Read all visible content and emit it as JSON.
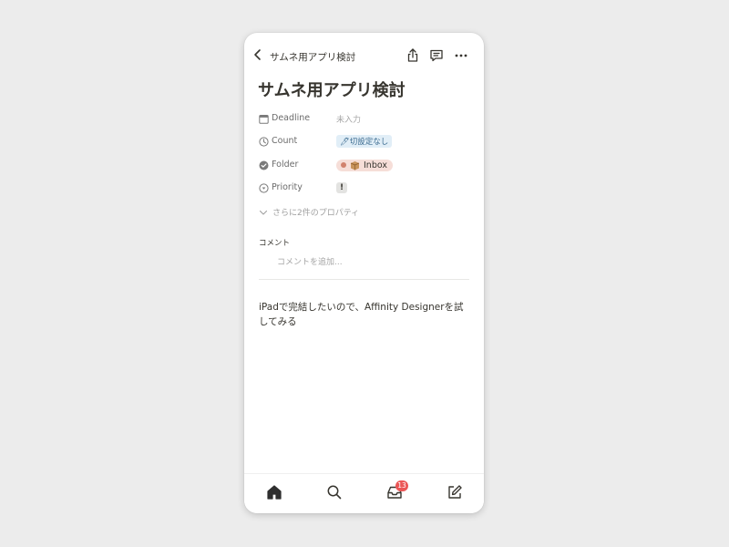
{
  "header": {
    "title": "サムネ用アプリ検討"
  },
  "page": {
    "title": "サムネ用アプリ検討"
  },
  "properties": [
    {
      "label": "Deadline",
      "value": "未入力",
      "icon": "calendar-icon"
    },
    {
      "label": "Count",
      "value": "🖊切設定なし",
      "icon": "clock-icon"
    },
    {
      "label": "Folder",
      "value": "Inbox",
      "icon": "check-circle-icon"
    },
    {
      "label": "Priority",
      "value": "!",
      "icon": "dropdown-circle-icon"
    }
  ],
  "more_properties": "さらに2件のプロパティ",
  "comments": {
    "label": "コメント",
    "placeholder": "コメントを追加..."
  },
  "body": {
    "text": "iPadで完結したいので、Affinity Designerを試してみる"
  },
  "bottom_nav": {
    "items": [
      "home-icon",
      "search-icon",
      "inbox-icon",
      "compose-icon"
    ],
    "inbox_badge": "13"
  },
  "colors": {
    "background": "#ececec",
    "count_chip_bg": "#e1eef7",
    "folder_chip_bg": "#f6ded8",
    "badge": "#eb5757"
  }
}
